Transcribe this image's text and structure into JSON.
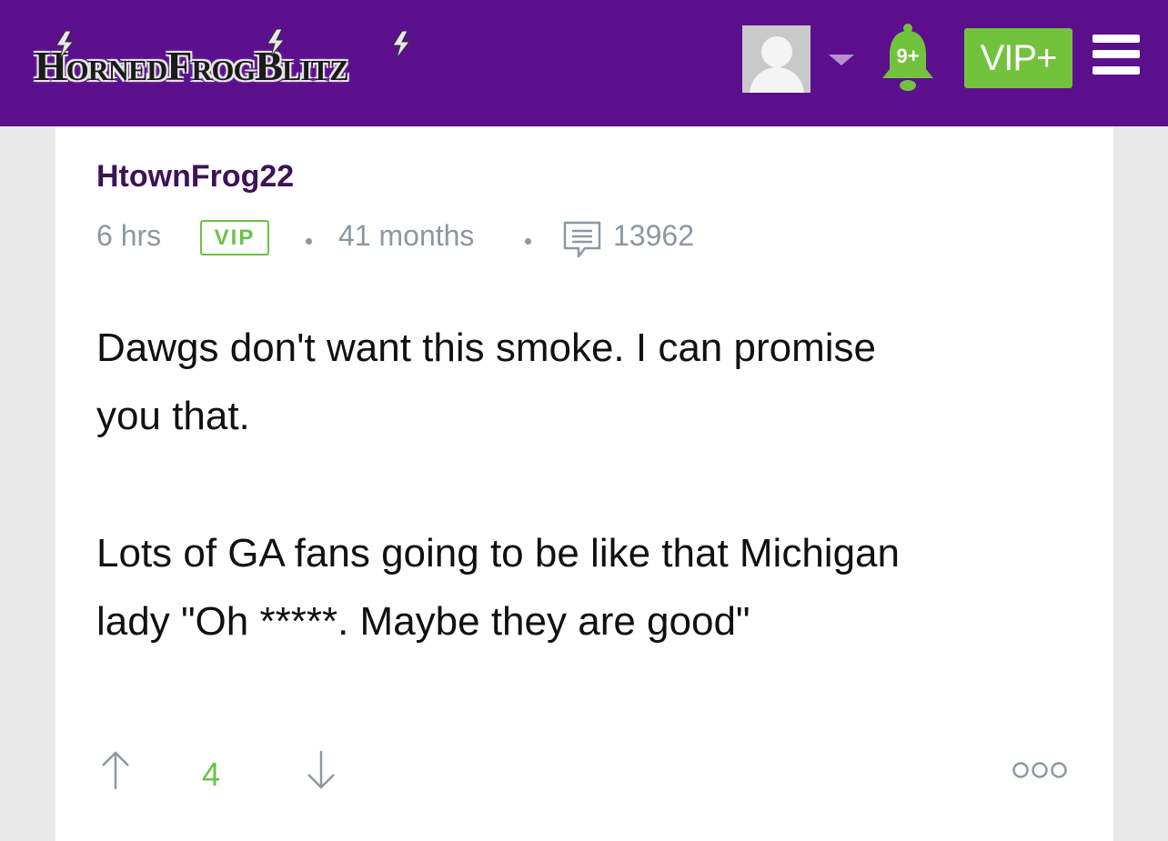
{
  "header": {
    "logo_text": "HornedFrogBlitz",
    "notifications_badge": "9+",
    "vip_button_label": "VIP+",
    "colors": {
      "bar": "#5b0f8d",
      "accent_green": "#73c23d"
    },
    "icons": [
      "avatar-icon",
      "dropdown-caret-icon",
      "bell-icon",
      "hamburger-menu-icon"
    ]
  },
  "post": {
    "username": "HtownFrog22",
    "time_ago": "6 hrs",
    "badge": "VIP",
    "membership": "41 months",
    "post_count": "13962",
    "lines": [
      "Dawgs don't want this smoke. I can promise",
      "you that.",
      "Lots of GA fans going to be like that Michigan",
      "lady \"Oh *****. Maybe they are good\""
    ],
    "score": "4",
    "icons": [
      "comment-count-icon",
      "upvote-arrow-icon",
      "downvote-arrow-icon",
      "more-options-icon"
    ]
  }
}
